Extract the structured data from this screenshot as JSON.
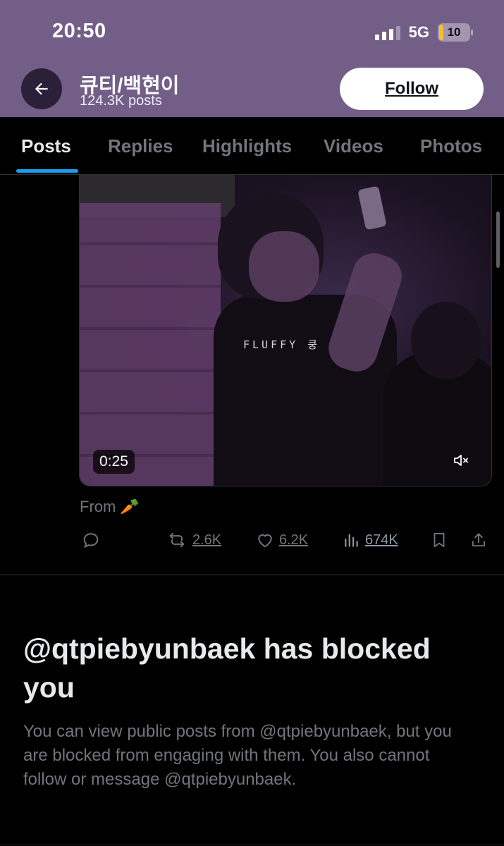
{
  "status_bar": {
    "time": "20:50",
    "network": "5G",
    "battery": "10",
    "battery_level_percent": 10,
    "signal_bars_filled": 3
  },
  "header": {
    "back_icon": "arrow-left-icon",
    "profile_name": "큐티/백현이",
    "post_count": "124.3K posts",
    "follow_label": "Follow"
  },
  "tabs": [
    {
      "label": "Posts",
      "active": true
    },
    {
      "label": "Replies",
      "active": false
    },
    {
      "label": "Highlights",
      "active": false
    },
    {
      "label": "Videos",
      "active": false
    },
    {
      "label": "Photos",
      "active": false
    }
  ],
  "post": {
    "video": {
      "duration": "0:25",
      "overlay_text": "FLUFFY 쿵",
      "mute_icon": "speaker-muted-icon"
    },
    "from_label": "From",
    "from_emoji": "🥕",
    "actions": {
      "reply_icon": "reply-bubble-icon",
      "repost_count": "2.6K",
      "like_count": "6.2K",
      "view_count": "674K",
      "bookmark_icon": "bookmark-icon",
      "share_icon": "share-icon"
    }
  },
  "blocked": {
    "title": "@qtpiebyunbaek has blocked you",
    "message": "You can view public posts from @qtpiebyunbaek, but you are blocked from engaging with them. You also cannot follow or message @qtpiebyunbaek."
  },
  "colors": {
    "header_bg": "#725e87",
    "accent": "#1d9bf0",
    "muted_text": "#71767b"
  }
}
